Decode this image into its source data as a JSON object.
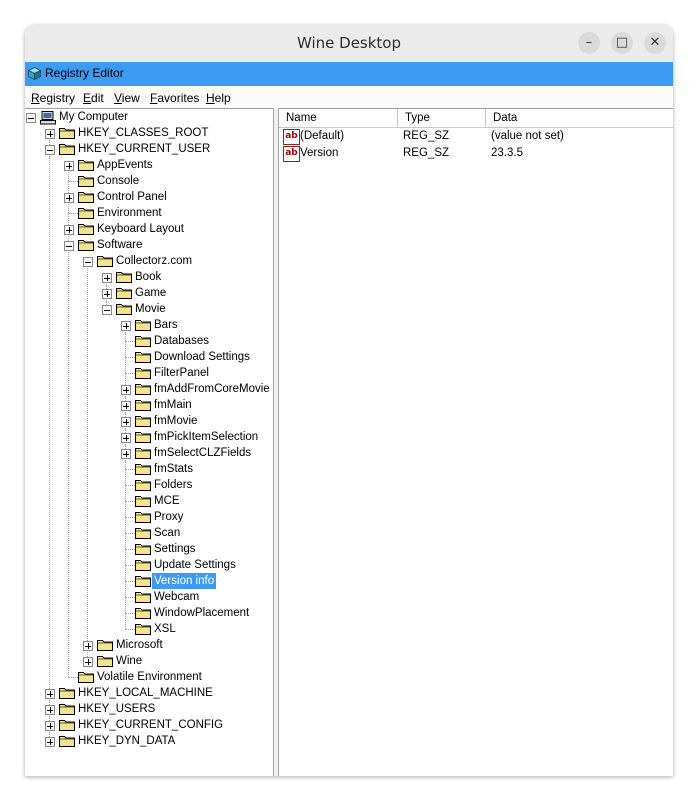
{
  "window": {
    "title": "Wine Desktop",
    "minimize": "–",
    "maximize": "□",
    "close": "✕"
  },
  "app": {
    "title": "Registry Editor"
  },
  "menu": [
    "Registry",
    "Edit",
    "View",
    "Favorites",
    "Help"
  ],
  "tree": [
    {
      "label": "My Computer",
      "expander": "minus",
      "icon": "computer-icon"
    },
    {
      "label": "HKEY_CLASSES_ROOT",
      "expander": "plus"
    },
    {
      "label": "HKEY_CURRENT_USER",
      "expander": "minus"
    },
    {
      "label": "AppEvents",
      "expander": "plus"
    },
    {
      "label": "Console",
      "expander": "none"
    },
    {
      "label": "Control Panel",
      "expander": "plus"
    },
    {
      "label": "Environment",
      "expander": "none"
    },
    {
      "label": "Keyboard Layout",
      "expander": "plus"
    },
    {
      "label": "Software",
      "expander": "minus"
    },
    {
      "label": "Collectorz.com",
      "expander": "minus"
    },
    {
      "label": "Book",
      "expander": "plus"
    },
    {
      "label": "Game",
      "expander": "plus"
    },
    {
      "label": "Movie",
      "expander": "minus"
    },
    {
      "label": "Bars",
      "expander": "plus"
    },
    {
      "label": "Databases",
      "expander": "none"
    },
    {
      "label": "Download Settings",
      "expander": "none"
    },
    {
      "label": "FilterPanel",
      "expander": "none"
    },
    {
      "label": "fmAddFromCoreMovie",
      "expander": "plus"
    },
    {
      "label": "fmMain",
      "expander": "plus"
    },
    {
      "label": "fmMovie",
      "expander": "plus"
    },
    {
      "label": "fmPickItemSelection",
      "expander": "plus"
    },
    {
      "label": "fmSelectCLZFields",
      "expander": "plus"
    },
    {
      "label": "fmStats",
      "expander": "none"
    },
    {
      "label": "Folders",
      "expander": "none"
    },
    {
      "label": "MCE",
      "expander": "none"
    },
    {
      "label": "Proxy",
      "expander": "none"
    },
    {
      "label": "Scan",
      "expander": "none"
    },
    {
      "label": "Settings",
      "expander": "none"
    },
    {
      "label": "Update Settings",
      "expander": "none"
    },
    {
      "label": "Version info",
      "expander": "none",
      "selected": true
    },
    {
      "label": "Webcam",
      "expander": "none"
    },
    {
      "label": "WindowPlacement",
      "expander": "none"
    },
    {
      "label": "XSL",
      "expander": "none"
    },
    {
      "label": "Microsoft",
      "expander": "plus"
    },
    {
      "label": "Wine",
      "expander": "plus"
    },
    {
      "label": "Volatile Environment",
      "expander": "none"
    },
    {
      "label": "HKEY_LOCAL_MACHINE",
      "expander": "plus"
    },
    {
      "label": "HKEY_USERS",
      "expander": "plus"
    },
    {
      "label": "HKEY_CURRENT_CONFIG",
      "expander": "plus"
    },
    {
      "label": "HKEY_DYN_DATA",
      "expander": "plus"
    }
  ],
  "list": {
    "columns": [
      "Name",
      "Type",
      "Data"
    ],
    "rows": [
      {
        "icon": "ab",
        "name": "(Default)",
        "type": "REG_SZ",
        "data": "(value not set)"
      },
      {
        "icon": "ab",
        "name": "Version",
        "type": "REG_SZ",
        "data": "23.3.5"
      }
    ]
  },
  "colors": {
    "accent": "#3d9bf4",
    "folder": "#f5e38a"
  }
}
